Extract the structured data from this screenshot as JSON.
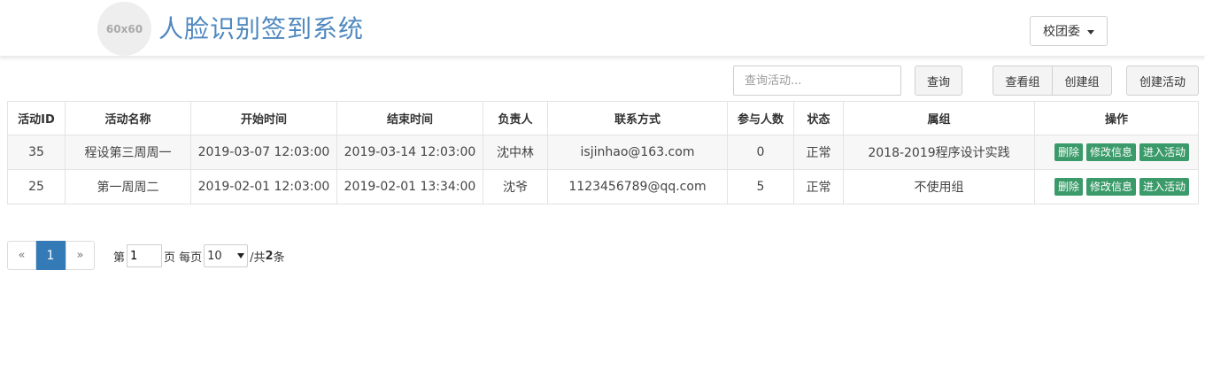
{
  "header": {
    "logo_text": "60x60",
    "title": "人脸识别签到系统",
    "user_menu": "校团委"
  },
  "toolbar": {
    "search_placeholder": "查询活动...",
    "query_label": "查询",
    "view_group_label": "查看组",
    "create_group_label": "创建组",
    "create_activity_label": "创建活动"
  },
  "table": {
    "columns": [
      "活动ID",
      "活动名称",
      "开始时间",
      "结束时间",
      "负责人",
      "联系方式",
      "参与人数",
      "状态",
      "属组",
      "操作"
    ],
    "rows": [
      {
        "id": "35",
        "name": "程设第三周周一",
        "start": "2019-03-07 12:03:00",
        "end": "2019-03-14 12:03:00",
        "owner": "沈中林",
        "contact": "isjinhao@163.com",
        "count": "0",
        "status": "正常",
        "group": "2018-2019程序设计实践"
      },
      {
        "id": "25",
        "name": "第一周周二",
        "start": "2019-02-01 12:03:00",
        "end": "2019-02-01 13:34:00",
        "owner": "沈爷",
        "contact": "1123456789@qq.com",
        "count": "5",
        "status": "正常",
        "group": "不使用组"
      }
    ],
    "actions": {
      "delete": "删除",
      "edit": "修改信息",
      "enter": "进入活动"
    }
  },
  "pagination": {
    "prev": "«",
    "current": "1",
    "next": "»",
    "page_prefix": "第",
    "page_value": "1",
    "page_suffix": "页 每页",
    "page_size": "10",
    "total_prefix": "/共",
    "total_count": "2",
    "total_suffix": "条"
  },
  "colors": {
    "title": "#4f88c0",
    "action_button": "#3b9a6a",
    "active_page": "#337ab7"
  }
}
